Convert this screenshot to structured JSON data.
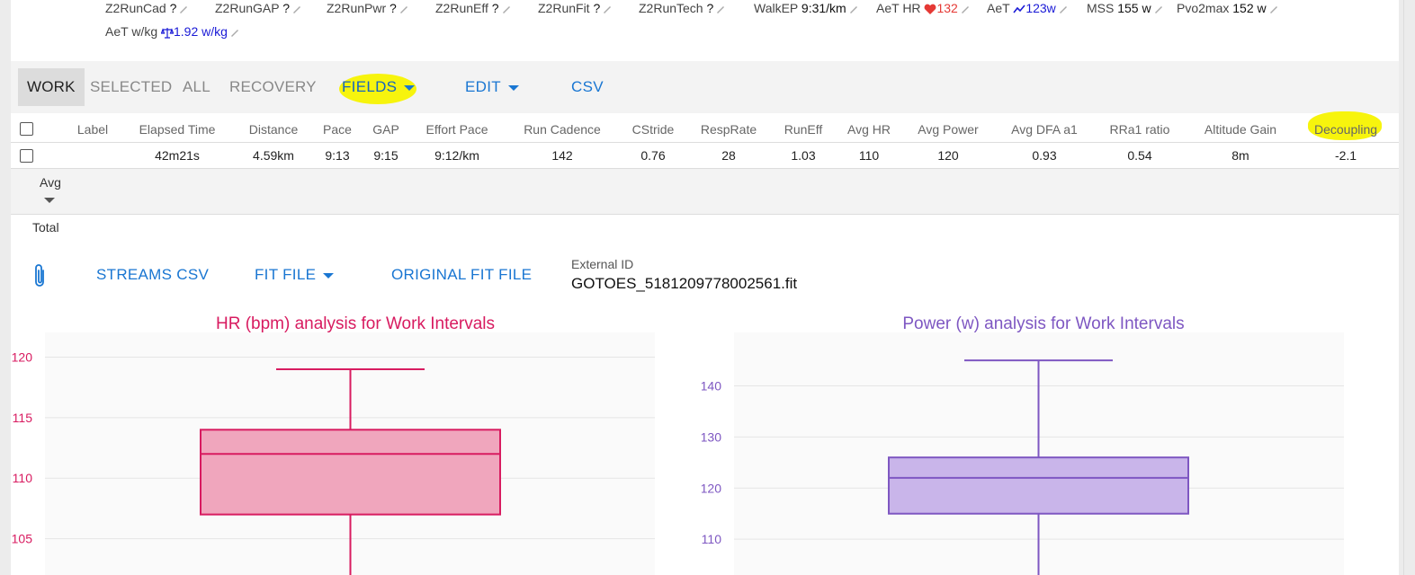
{
  "metrics": {
    "row1": [
      {
        "label": "Z2RunCad",
        "value": "?"
      },
      {
        "label": "Z2RunGAP",
        "value": "?"
      },
      {
        "label": "Z2RunPwr",
        "value": "?"
      },
      {
        "label": "Z2RunEff",
        "value": "?"
      },
      {
        "label": "Z2RunFit",
        "value": "?"
      },
      {
        "label": "Z2RunTech",
        "value": "?"
      },
      {
        "label": "WalkEP",
        "value": "9:31/km"
      },
      {
        "label": "AeT HR",
        "value": "132"
      },
      {
        "label": "AeT",
        "value": "123w"
      },
      {
        "label": "MSS",
        "value": "155 w"
      },
      {
        "label": "Pvo2max",
        "value": "152 w"
      }
    ],
    "row2": [
      {
        "label": "AeT w/kg",
        "value": "1.92 w/kg"
      }
    ]
  },
  "toolbar": {
    "tabs": [
      "WORK",
      "SELECTED",
      "ALL",
      "RECOVERY"
    ],
    "fields_label": "FIELDS",
    "edit_label": "EDIT",
    "csv_label": "CSV"
  },
  "table": {
    "headers": [
      "Label",
      "Elapsed Time",
      "Distance",
      "Pace",
      "GAP",
      "Effort Pace",
      "Run Cadence",
      "CStride",
      "RespRate",
      "RunEff",
      "Avg HR",
      "Avg Power",
      "Avg DFA a1",
      "RRa1 ratio",
      "Altitude Gain",
      "Decoupling"
    ],
    "row": [
      "",
      "42m21s",
      "4.59km",
      "9:13",
      "9:15",
      "9:12/km",
      "142",
      "0.76",
      "28",
      "1.03",
      "110",
      "120",
      "0.93",
      "0.54",
      "8m",
      "-2.1"
    ],
    "avg_label": "Avg",
    "total_label": "Total"
  },
  "files": {
    "streams_csv": "STREAMS CSV",
    "fit_file": "FIT FILE",
    "original_fit": "ORIGINAL FIT FILE",
    "external_id_label": "External ID",
    "external_id_value": "GOTOES_5181209778002561.fit"
  },
  "colors": {
    "blue": "#1976d2",
    "highlight": "#f7f300",
    "hr": "#d81b60",
    "hr_fill": "#f0a6bd",
    "power": "#7e57c2",
    "power_fill": "#c9b5ea",
    "heart": "#e53935"
  },
  "chart_data": [
    {
      "type": "box",
      "title": "HR (bpm) analysis for Work Intervals",
      "ylim": [
        102,
        121
      ],
      "yticks": [
        105,
        110,
        115,
        120
      ],
      "min": 102,
      "q1": 107,
      "median": 112,
      "q3": 114,
      "max": 119
    },
    {
      "type": "box",
      "title": "Power (w) analysis for Work Intervals",
      "ylim": [
        103,
        148
      ],
      "yticks": [
        110,
        120,
        130,
        140
      ],
      "min": 103,
      "q1": 115,
      "median": 122,
      "q3": 126,
      "max": 145
    }
  ]
}
